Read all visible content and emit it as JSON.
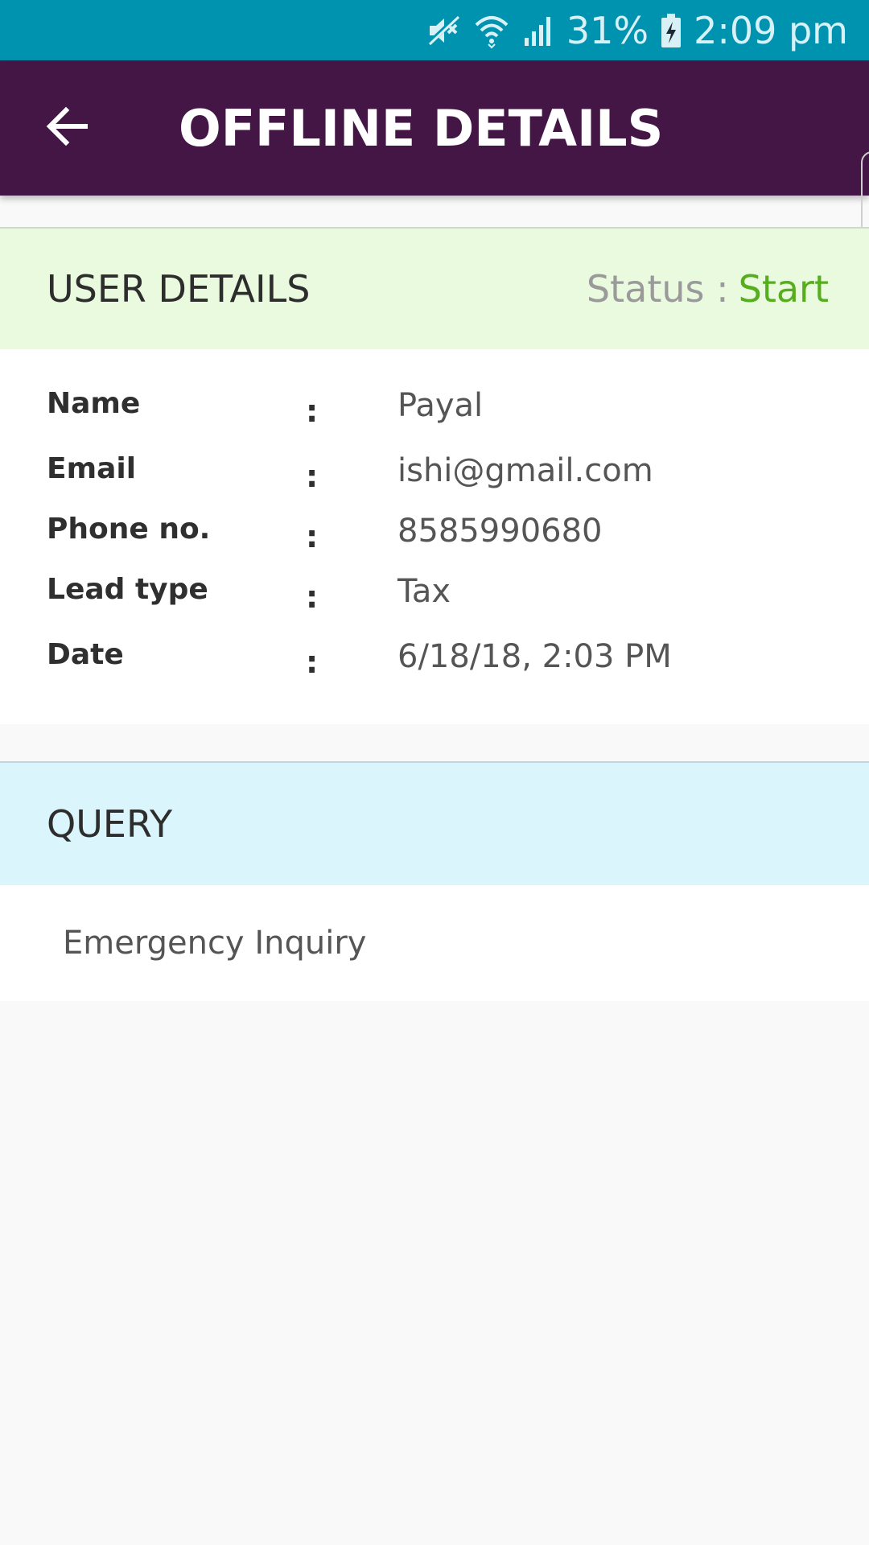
{
  "status_bar": {
    "battery": "31%",
    "time": "2:09 pm",
    "icons": [
      "mute-icon",
      "wifi-icon",
      "signal-icon",
      "battery-charging-icon"
    ]
  },
  "app_bar": {
    "title": "OFFLINE DETAILS",
    "back_icon": "arrow-back-icon"
  },
  "user_details": {
    "title": "USER DETAILS",
    "status_label": "Status :",
    "status_value": "Start",
    "rows": [
      {
        "label": "Name",
        "colon": ":",
        "value": "Payal"
      },
      {
        "label": "Email",
        "colon": ":",
        "value": "ishi@gmail.com"
      },
      {
        "label": "Phone no.",
        "colon": ":",
        "value": "8585990680"
      },
      {
        "label": "Lead type",
        "colon": ":",
        "value": "Tax"
      },
      {
        "label": "Date",
        "colon": ":",
        "value": "6/18/18, 2:03 PM"
      }
    ]
  },
  "query": {
    "title": "QUERY",
    "text": "Emergency Inquiry"
  },
  "colors": {
    "status_bar": "#0093b0",
    "app_bar": "#431646",
    "user_header_bg": "#eafade",
    "query_header_bg": "#daf5fb",
    "status_start": "#56ad1e"
  }
}
